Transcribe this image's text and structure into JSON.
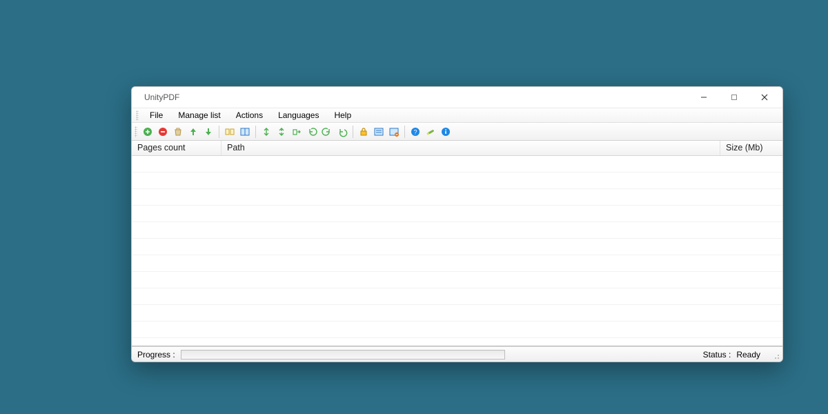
{
  "title": "UnityPDF",
  "menu": {
    "file": "File",
    "manage": "Manage list",
    "actions": "Actions",
    "languages": "Languages",
    "help": "Help"
  },
  "columns": {
    "pages": "Pages count",
    "path": "Path",
    "size": "Size (Mb)"
  },
  "status": {
    "progress_label": "Progress :",
    "status_label": "Status :",
    "status_value": "Ready"
  },
  "toolbar": [
    "add",
    "remove",
    "clear",
    "move-up",
    "move-down",
    "sep",
    "merge",
    "split",
    "sep",
    "split-size",
    "split-pages",
    "extract",
    "rotate-left",
    "rotate-right",
    "undo",
    "sep",
    "protect",
    "metadata",
    "metadata-remove",
    "sep",
    "help",
    "settings",
    "about"
  ],
  "rows": []
}
